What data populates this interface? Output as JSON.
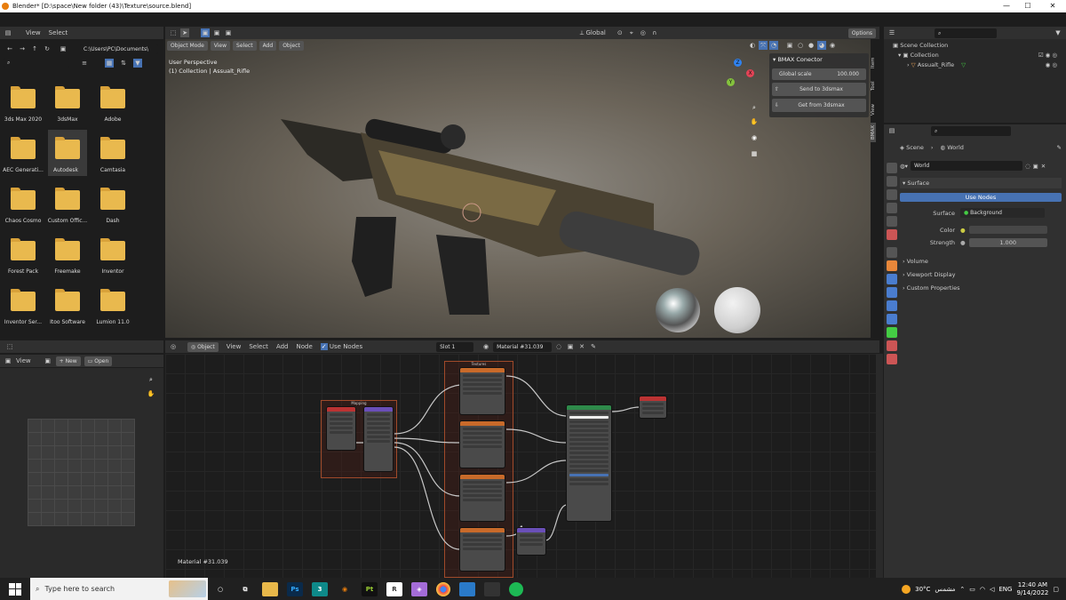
{
  "window": {
    "title": "Blender* [D:\\space\\New folder (43)\\Texture\\source.blend]"
  },
  "filebrowser": {
    "menu": [
      "View",
      "Select"
    ],
    "path": "C:\\Users\\PC\\Documents\\",
    "folders": [
      "3ds Max 2020",
      "3dsMax",
      "Adobe",
      "AEC Generati...",
      "Autodesk",
      "Camtasia",
      "Chaos Cosmo",
      "Custom Offic...",
      "Dash",
      "Forest Pack",
      "Freemake",
      "Inventor",
      "Inventor Ser...",
      "Itoo Software",
      "Lumion 11.0"
    ]
  },
  "viewport": {
    "mode": "Object Mode",
    "menus": [
      "View",
      "Select",
      "Add",
      "Object"
    ],
    "transform": "Global",
    "options": "Options",
    "overlay_title": "User Perspective",
    "overlay_sub": "(1) Collection | Assualt_Rifle",
    "gizmo": {
      "x": "X",
      "y": "Y",
      "z": "Z"
    }
  },
  "bmax": {
    "title": "BMAX Conector",
    "scale_label": "Global scale",
    "scale_value": "100.000",
    "send": "Send to 3dsmax",
    "get": "Get from 3dsmax",
    "tabs": [
      "Item",
      "Tool",
      "View",
      "BMAX"
    ]
  },
  "outliner": {
    "root": "Scene Collection",
    "collection": "Collection",
    "object": "Assualt_Rifle"
  },
  "properties": {
    "scene": "Scene",
    "world_tab": "World",
    "world_name": "World",
    "surface_header": "Surface",
    "use_nodes": "Use Nodes",
    "surface_label": "Surface",
    "surface_value": "Background",
    "color_label": "Color",
    "strength_label": "Strength",
    "strength_value": "1.000",
    "volume": "Volume",
    "viewport_display": "Viewport Display",
    "custom_props": "Custom Properties"
  },
  "imageeditor": {
    "menus": [
      "View"
    ],
    "new": "New",
    "open": "Open"
  },
  "nodeeditor": {
    "type": "Object",
    "menus": [
      "View",
      "Select",
      "Add",
      "Node"
    ],
    "use_nodes": "Use Nodes",
    "slot": "Slot 1",
    "material": "Material #31.039",
    "footer": "Material #31.039",
    "frame_mapping": "Mapping",
    "frame_textures": "Textures"
  },
  "taskbar": {
    "search_placeholder": "Type here to search",
    "weather": "30°C",
    "weather_text": "مشمس",
    "lang": "ENG",
    "time": "12:40 AM",
    "date": "9/14/2022"
  },
  "colors": {
    "accent": "#4772b3",
    "panel": "#303030",
    "bg": "#1d1d1d"
  }
}
